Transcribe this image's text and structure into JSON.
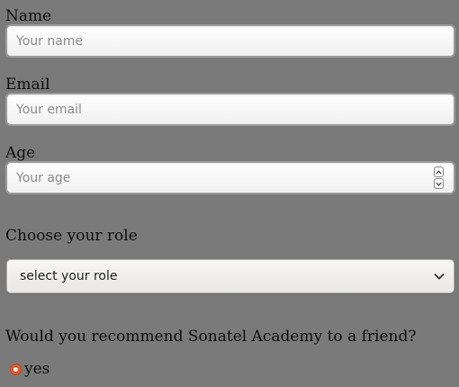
{
  "form": {
    "name": {
      "label": "Name",
      "placeholder": "Your name",
      "value": ""
    },
    "email": {
      "label": "Email",
      "placeholder": "Your email",
      "value": ""
    },
    "age": {
      "label": "Age",
      "placeholder": "Your age",
      "value": ""
    },
    "role": {
      "label": "Choose your role",
      "selected": "select your role"
    },
    "recommend": {
      "question": "Would you recommend Sonatel Academy to a friend?",
      "options": [
        {
          "label": "yes",
          "checked": true
        }
      ]
    }
  },
  "icons": {
    "age_spinner_up": "chevron-up-icon",
    "age_spinner_down": "chevron-down-icon",
    "role_dropdown": "chevron-down-icon"
  },
  "colors": {
    "page_background": "#7a7a7a",
    "radio_accent": "#e1582d"
  }
}
